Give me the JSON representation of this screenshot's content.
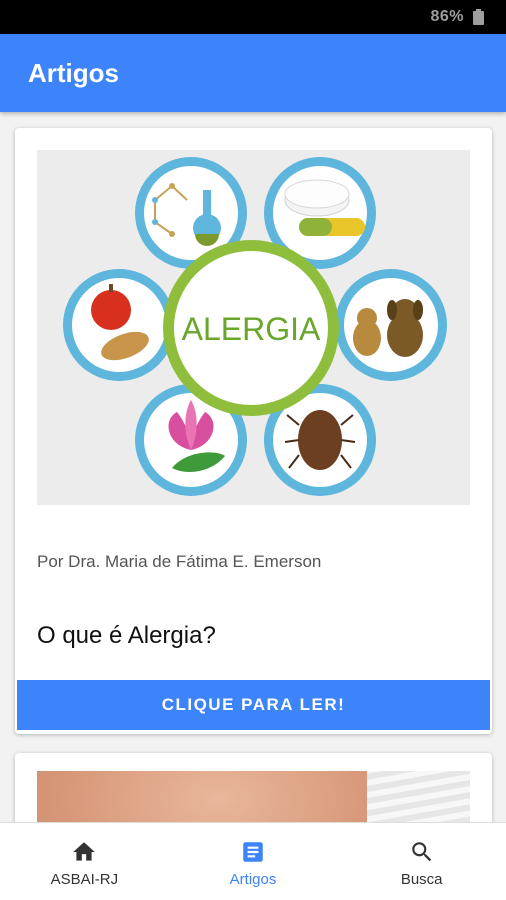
{
  "status_bar": {
    "battery_percent": "86%"
  },
  "app_bar": {
    "title": "Artigos"
  },
  "articles": [
    {
      "image_text": "ALERGIA",
      "author": "Por Dra. Maria de Fátima E. Emerson",
      "title": "O que é Alergia?",
      "button_label": "CLIQUE PARA LER!"
    }
  ],
  "bottom_nav": {
    "items": [
      {
        "label": "ASBAI-RJ",
        "icon": "home-icon",
        "active": false
      },
      {
        "label": "Artigos",
        "icon": "article-icon",
        "active": true
      },
      {
        "label": "Busca",
        "icon": "search-icon",
        "active": false
      }
    ]
  },
  "colors": {
    "primary": "#3d83f9",
    "nav_inactive": "#333333"
  }
}
